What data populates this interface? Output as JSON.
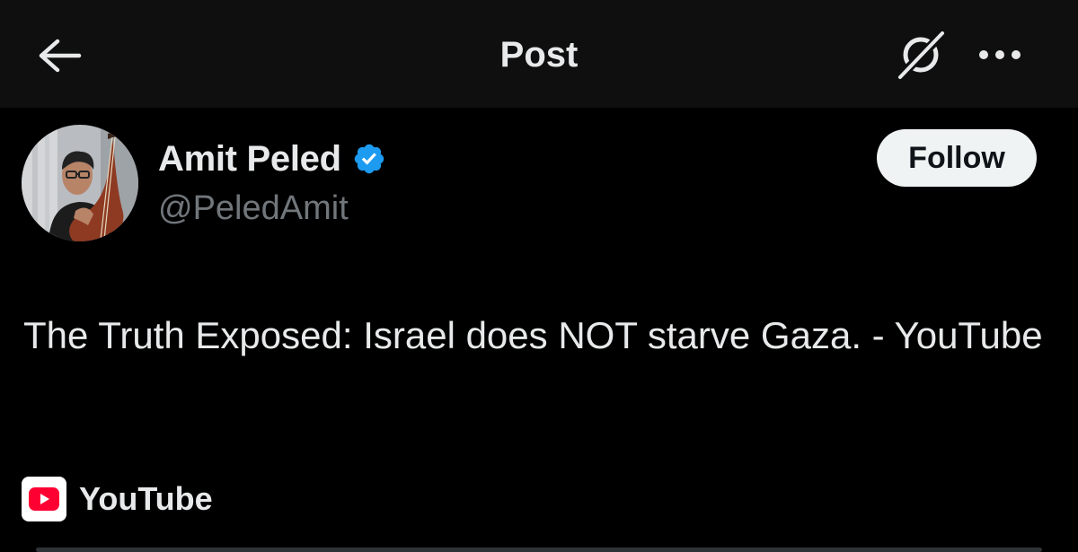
{
  "header": {
    "title": "Post",
    "back_icon": "arrow-left-icon",
    "grok_icon": "grok-icon",
    "more_icon": "more-horizontal-icon"
  },
  "author": {
    "display_name": "Amit Peled",
    "handle": "@PeledAmit",
    "verified": true,
    "verified_color": "#1d9bf0",
    "avatar_icon": "avatar"
  },
  "follow_button": {
    "label": "Follow"
  },
  "post": {
    "text": "The Truth Exposed: Israel does NOT starve Gaza. - YouTube"
  },
  "link_card": {
    "source_icon": "youtube-icon",
    "source_label": "YouTube",
    "icon_color": "#ff0033"
  },
  "colors": {
    "background": "#000000",
    "header_background": "#0f0f0f",
    "primary_text": "#e7e9ea",
    "secondary_text": "#71767b",
    "follow_bg": "#eff3f4",
    "follow_text": "#0f1419"
  }
}
